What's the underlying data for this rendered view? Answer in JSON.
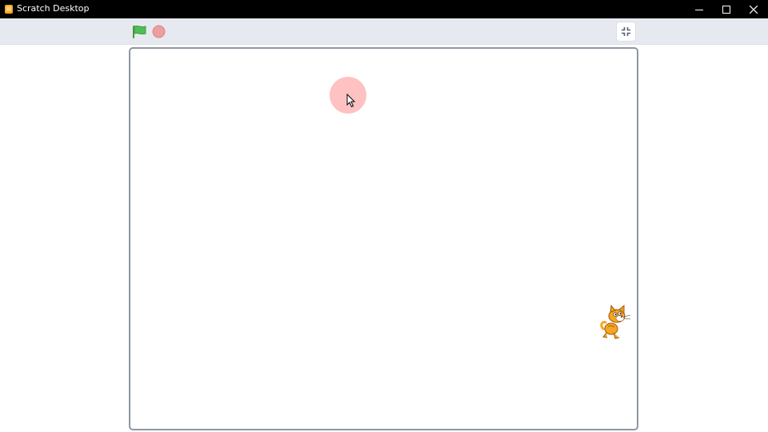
{
  "window": {
    "title": "Scratch Desktop",
    "controls": {
      "minimize": "minimize-icon",
      "maximize": "maximize-icon",
      "close": "close-icon"
    }
  },
  "toolbar": {
    "green_flag": "green-flag-icon",
    "stop": "stop-icon",
    "exit_fullscreen": "unfullscreen-icon"
  },
  "stage": {
    "sprites": [
      "cat-sprite"
    ]
  },
  "colors": {
    "titlebar": "#000000",
    "toolbar": "#e6eaf0",
    "stage_border": "#8e96a3",
    "green_flag": "#4cad4c",
    "stop": "#eb9f9f",
    "click_indicator": "#ffa0a0",
    "cat_orange": "#f6a623"
  }
}
